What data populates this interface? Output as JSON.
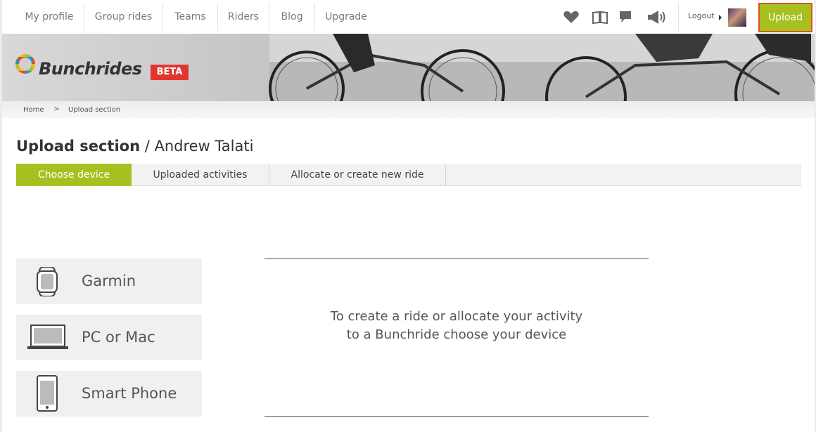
{
  "nav": {
    "items": [
      {
        "label": "My profile"
      },
      {
        "label": "Group rides"
      },
      {
        "label": "Teams"
      },
      {
        "label": "Riders"
      },
      {
        "label": "Blog"
      },
      {
        "label": "Upgrade"
      }
    ],
    "icons": [
      "heart-icon",
      "book-icon",
      "speech-bubble-icon",
      "megaphone-icon"
    ],
    "logout_label": "Logout",
    "upload_label": "Upload"
  },
  "banner": {
    "logo_text": "Bunchrides",
    "beta_label": "BETA"
  },
  "breadcrumb": {
    "home": "Home",
    "separator": ">",
    "current": "Upload section"
  },
  "page": {
    "title_main": "Upload section",
    "title_sep": " / ",
    "title_user": "Andrew Talati"
  },
  "tabs": [
    {
      "label": "Choose device",
      "active": true
    },
    {
      "label": "Uploaded activities",
      "active": false
    },
    {
      "label": "Allocate or create new ride",
      "active": false
    }
  ],
  "devices": [
    {
      "label": "Garmin",
      "icon": "garmin-watch-icon"
    },
    {
      "label": "PC or Mac",
      "icon": "laptop-icon"
    },
    {
      "label": "Smart Phone",
      "icon": "smartphone-icon"
    }
  ],
  "message": {
    "line1": "To create a ride or allocate your activity",
    "line2": "to a Bunchride choose your device"
  },
  "colors": {
    "accent": "#a7c020",
    "beta": "#e2352f",
    "upload_border": "#d9541e"
  }
}
